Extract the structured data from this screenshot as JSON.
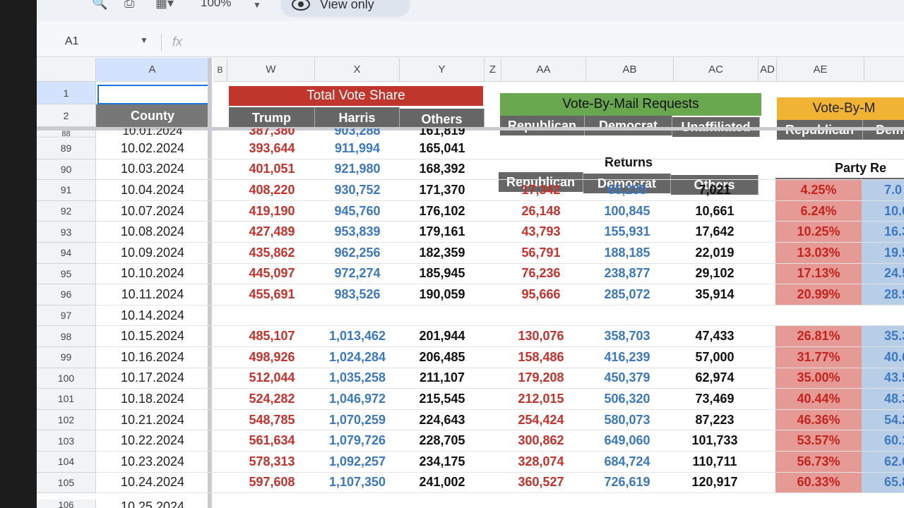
{
  "toolbar": {
    "zoom": "100%",
    "view_only": "View only"
  },
  "formula_bar": {
    "name_box": "A1",
    "fx": "fx"
  },
  "columns": {
    "A": "A",
    "B": "B",
    "W": "W",
    "X": "X",
    "Y": "Y",
    "Z": "Z",
    "AA": "AA",
    "AB": "AB",
    "AC": "AC",
    "AD": "AD",
    "AE": "AE"
  },
  "header_rows": [
    "1",
    "2"
  ],
  "county_label": "County",
  "groups": {
    "total_vote_share": "Total Vote Share",
    "vbm_requests": "Vote-By-Mail Requests",
    "vbm_partial": "Vote-By-M",
    "returns": "Returns",
    "party_re": "Party Re"
  },
  "subheaders": {
    "trump": "Trump",
    "harris": "Harris",
    "others": "Others",
    "republican": "Republican",
    "democrat": "Democrat",
    "unaffiliated": "Unaffiliated",
    "dem_partial": "Dem"
  },
  "partial_top": {
    "row": "88",
    "date": "10.01.2024",
    "trump": "387,380",
    "harris": "903,288",
    "others": "161,819"
  },
  "rows": [
    {
      "row": "89",
      "date": "10.02.2024",
      "trump": "393,644",
      "harris": "911,994",
      "others": "165,041",
      "rep": "",
      "dem": "",
      "oth": "",
      "pct": "",
      "pctd": ""
    },
    {
      "row": "90",
      "date": "10.03.2024",
      "trump": "401,051",
      "harris": "921,980",
      "others": "168,392",
      "rep": "",
      "dem": "",
      "oth": "",
      "pct": "",
      "pctd": ""
    },
    {
      "row": "91",
      "date": "10.04.2024",
      "trump": "408,220",
      "harris": "930,752",
      "others": "171,370",
      "rep": "17,342",
      "dem": "65,235",
      "oth": "7,021",
      "pct": "4.25%",
      "pctd": "7.0"
    },
    {
      "row": "92",
      "date": "10.07.2024",
      "trump": "419,190",
      "harris": "945,760",
      "others": "176,102",
      "rep": "26,148",
      "dem": "100,845",
      "oth": "10,661",
      "pct": "6.24%",
      "pctd": "10.0"
    },
    {
      "row": "93",
      "date": "10.08.2024",
      "trump": "427,489",
      "harris": "953,839",
      "others": "179,161",
      "rep": "43,793",
      "dem": "155,931",
      "oth": "17,642",
      "pct": "10.25%",
      "pctd": "16.3"
    },
    {
      "row": "94",
      "date": "10.09.2024",
      "trump": "435,862",
      "harris": "962,256",
      "others": "182,359",
      "rep": "56,791",
      "dem": "188,185",
      "oth": "22,019",
      "pct": "13.03%",
      "pctd": "19.5"
    },
    {
      "row": "95",
      "date": "10.10.2024",
      "trump": "445,097",
      "harris": "972,274",
      "others": "185,945",
      "rep": "76,236",
      "dem": "238,877",
      "oth": "29,102",
      "pct": "17.13%",
      "pctd": "24.5"
    },
    {
      "row": "96",
      "date": "10.11.2024",
      "trump": "455,691",
      "harris": "983,526",
      "others": "190,059",
      "rep": "95,666",
      "dem": "285,072",
      "oth": "35,914",
      "pct": "20.99%",
      "pctd": "28.9"
    },
    {
      "row": "97",
      "date": "10.14.2024",
      "trump": "",
      "harris": "",
      "others": "",
      "rep": "",
      "dem": "",
      "oth": "",
      "pct": "",
      "pctd": ""
    },
    {
      "row": "98",
      "date": "10.15.2024",
      "trump": "485,107",
      "harris": "1,013,462",
      "others": "201,944",
      "rep": "130,076",
      "dem": "358,703",
      "oth": "47,433",
      "pct": "26.81%",
      "pctd": "35.3"
    },
    {
      "row": "99",
      "date": "10.16.2024",
      "trump": "498,926",
      "harris": "1,024,284",
      "others": "206,485",
      "rep": "158,486",
      "dem": "416,239",
      "oth": "57,000",
      "pct": "31.77%",
      "pctd": "40.6"
    },
    {
      "row": "100",
      "date": "10.17.2024",
      "trump": "512,044",
      "harris": "1,035,258",
      "others": "211,107",
      "rep": "179,208",
      "dem": "450,379",
      "oth": "62,974",
      "pct": "35.00%",
      "pctd": "43.5"
    },
    {
      "row": "101",
      "date": "10.18.2024",
      "trump": "524,282",
      "harris": "1,046,972",
      "others": "215,545",
      "rep": "212,015",
      "dem": "506,320",
      "oth": "73,469",
      "pct": "40.44%",
      "pctd": "48.3"
    },
    {
      "row": "102",
      "date": "10.21.2024",
      "trump": "548,785",
      "harris": "1,070,259",
      "others": "224,643",
      "rep": "254,424",
      "dem": "580,073",
      "oth": "87,223",
      "pct": "46.36%",
      "pctd": "54.2"
    },
    {
      "row": "103",
      "date": "10.22.2024",
      "trump": "561,634",
      "harris": "1,079,726",
      "others": "228,705",
      "rep": "300,862",
      "dem": "649,060",
      "oth": "101,733",
      "pct": "53.57%",
      "pctd": "60.1"
    },
    {
      "row": "104",
      "date": "10.23.2024",
      "trump": "578,313",
      "harris": "1,092,257",
      "others": "234,175",
      "rep": "328,074",
      "dem": "684,724",
      "oth": "110,711",
      "pct": "56.73%",
      "pctd": "62.6"
    },
    {
      "row": "105",
      "date": "10.24.2024",
      "trump": "597,608",
      "harris": "1,107,350",
      "others": "241,002",
      "rep": "360,527",
      "dem": "726,619",
      "oth": "120,917",
      "pct": "60.33%",
      "pctd": "65.8"
    }
  ],
  "partial_bottom": {
    "row": "106",
    "date": "10.25.2024"
  },
  "colors": {
    "red_header": "#c0362c",
    "green_header": "#6aa84f",
    "orange_header": "#f1b333",
    "dark_subheader": "#666666"
  }
}
